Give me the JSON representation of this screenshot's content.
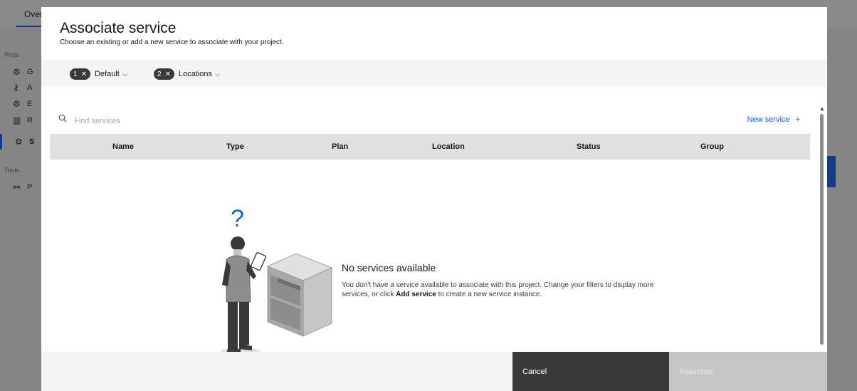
{
  "background": {
    "tab_label": "Over",
    "section_project": "Proje",
    "section_tools": "Tools",
    "items": [
      {
        "icon": "⚙",
        "letter": "G"
      },
      {
        "icon": "⚷",
        "letter": "A"
      },
      {
        "icon": "⚙",
        "letter": "E"
      },
      {
        "icon": "▥",
        "letter": "R"
      },
      {
        "icon": "⚙",
        "letter": "S"
      },
      {
        "icon": "⚯",
        "letter": "P"
      }
    ]
  },
  "modal": {
    "title": "Associate service",
    "subtitle": "Choose an existing or add a new service to associate with your project.",
    "filters": [
      {
        "count": "1",
        "label": "Default"
      },
      {
        "count": "2",
        "label": "Locations"
      }
    ],
    "search": {
      "placeholder": "Find services",
      "value": ""
    },
    "new_service_label": "New service",
    "columns": [
      "Name",
      "Type",
      "Plan",
      "Location",
      "Status",
      "Group"
    ],
    "empty_state": {
      "title": "No services available",
      "desc_before": "You don't have a service available to associate with this project. Change your filters to display more services, or click ",
      "desc_bold": "Add service",
      "desc_after": " to create a new service instance."
    },
    "footer": {
      "cancel_label": "Cancel",
      "associate_label": "Associate"
    }
  },
  "colors": {
    "accent": "#0f62fe",
    "question_mark": "#0f62fe",
    "tag_bg": "#393939",
    "cancel_bg": "#393939",
    "disabled_bg": "#c6c6c6"
  }
}
